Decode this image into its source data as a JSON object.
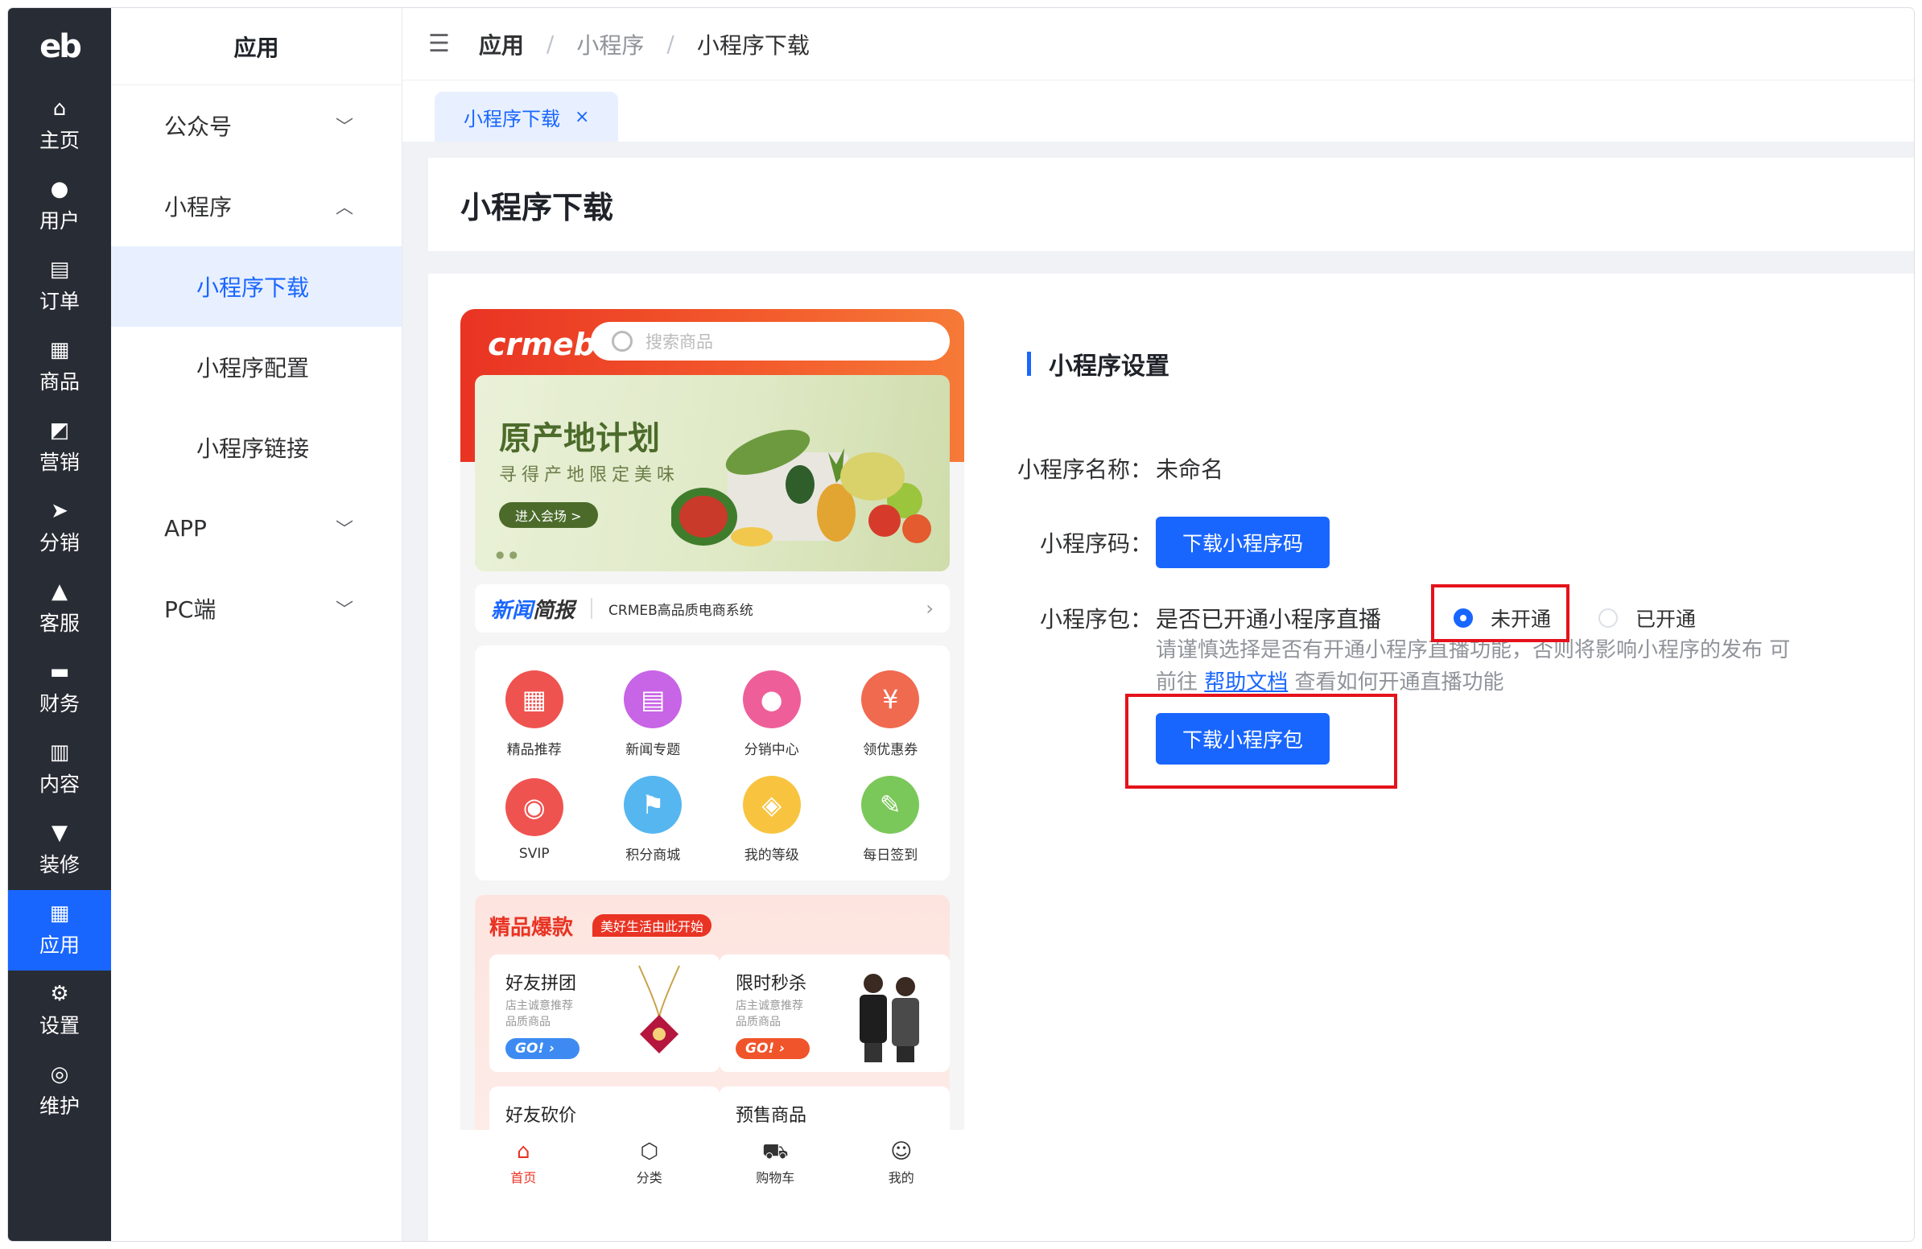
{
  "sidebar": {
    "logo": "eb",
    "items": [
      {
        "icon": "home-icon",
        "glyph": "⌂",
        "label": "主页"
      },
      {
        "icon": "user-icon",
        "glyph": "●",
        "label": "用户"
      },
      {
        "icon": "order-icon",
        "glyph": "▤",
        "label": "订单"
      },
      {
        "icon": "product-icon",
        "glyph": "▦",
        "label": "商品"
      },
      {
        "icon": "marketing-icon",
        "glyph": "◩",
        "label": "营销"
      },
      {
        "icon": "distribution-icon",
        "glyph": "➤",
        "label": "分销"
      },
      {
        "icon": "service-icon",
        "glyph": "▲",
        "label": "客服"
      },
      {
        "icon": "finance-icon",
        "glyph": "▬",
        "label": "财务"
      },
      {
        "icon": "content-icon",
        "glyph": "▥",
        "label": "内容"
      },
      {
        "icon": "decorate-icon",
        "glyph": "▼",
        "label": "装修"
      },
      {
        "icon": "app-icon",
        "glyph": "▦",
        "label": "应用",
        "active": true
      },
      {
        "icon": "settings-icon",
        "glyph": "⚙",
        "label": "设置"
      },
      {
        "icon": "maintain-icon",
        "glyph": "◎",
        "label": "维护"
      }
    ]
  },
  "submenu": {
    "title": "应用",
    "groups": {
      "wechat": {
        "label": "公众号",
        "chevron": "﹀"
      },
      "miniprogram": {
        "label": "小程序",
        "chevron": "︿"
      },
      "app": {
        "label": "APP",
        "chevron": "﹀"
      },
      "pc": {
        "label": "PC端",
        "chevron": "﹀"
      }
    },
    "mini_items": [
      "小程序下载",
      "小程序配置",
      "小程序链接"
    ]
  },
  "header": {
    "breadcrumbs": [
      "应用",
      "小程序",
      "小程序下载"
    ],
    "separator": "/"
  },
  "tabs": [
    {
      "label": "小程序下载",
      "close": "×"
    }
  ],
  "page": {
    "title": "小程序下载"
  },
  "preview": {
    "logo": "crmeb",
    "search_placeholder": "搜索商品",
    "banner": {
      "title": "原产地计划",
      "subtitle": "寻得产地限定美味",
      "button": "进入会场 >"
    },
    "news": {
      "tag_a": "新闻",
      "tag_b": "简报",
      "text": "CRMEB高品质电商系统",
      "arrow": "›"
    },
    "grid": [
      {
        "label": "精品推荐",
        "color": "#ef5350",
        "glyph": "▦"
      },
      {
        "label": "新闻专题",
        "color": "#c864e6",
        "glyph": "▤"
      },
      {
        "label": "分销中心",
        "color": "#ee5f9a",
        "glyph": "●"
      },
      {
        "label": "领优惠券",
        "color": "#f06a4f",
        "glyph": "¥"
      },
      {
        "label": "SVIP",
        "color": "#ef5350",
        "glyph": "◉"
      },
      {
        "label": "积分商城",
        "color": "#56b6f0",
        "glyph": "⚑"
      },
      {
        "label": "我的等级",
        "color": "#f8c440",
        "glyph": "◈"
      },
      {
        "label": "每日签到",
        "color": "#7bc85a",
        "glyph": "✎"
      }
    ],
    "hot": {
      "title": "精品爆款",
      "tag": "美好生活由此开始",
      "cards": [
        {
          "title": "好友拼团",
          "sub1": "店主诚意推荐",
          "sub2": "品质商品",
          "go": "GO!",
          "go_color": "#3d8bf2"
        },
        {
          "title": "限时秒杀",
          "sub1": "店主诚意推荐",
          "sub2": "品质商品",
          "go": "GO!",
          "go_color": "#f0542a"
        },
        {
          "title": "好友砍价"
        },
        {
          "title": "预售商品"
        }
      ]
    },
    "tabbar": [
      {
        "label": "首页",
        "glyph": "⌂",
        "active": true
      },
      {
        "label": "分类",
        "glyph": "⬡"
      },
      {
        "label": "购物车",
        "glyph": "⛟"
      },
      {
        "label": "我的",
        "glyph": "☺"
      }
    ]
  },
  "settings": {
    "section_title": "小程序设置",
    "name_label": "小程序名称：",
    "name_value": "未命名",
    "code_label": "小程序码：",
    "code_button": "下载小程序码",
    "package_label": "小程序包：",
    "live_question": "是否已开通小程序直播",
    "radio_options": [
      {
        "label": "未开通",
        "checked": true
      },
      {
        "label": "已开通",
        "checked": false
      }
    ],
    "hint_prefix": "请谨慎选择是否有开通小程序直播功能，否则将影响小程序的发布 可前往 ",
    "hint_link": "帮助文档",
    "hint_suffix": " 查看如何开通直播功能",
    "package_button": "下载小程序包"
  },
  "colors": {
    "primary": "#1966ff",
    "rail_bg": "#282c34",
    "highlight_box": "#e5121b",
    "brand_red": "#e93323"
  }
}
